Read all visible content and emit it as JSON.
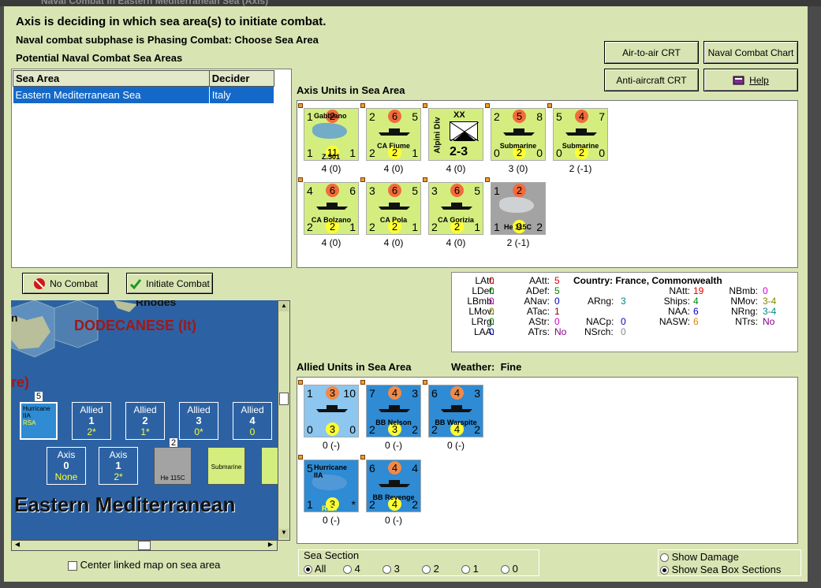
{
  "window_title": "Naval Combat in Eastern Mediterranean Sea (Axis)",
  "header": {
    "line1": "Axis is deciding in which sea area(s) to initiate combat.",
    "line2": "Naval combat subphase is Phasing Combat: Choose Sea Area",
    "line3": "Potential Naval Combat Sea Areas"
  },
  "toolbar": {
    "air_to_air": "Air-to-air CRT",
    "naval_chart": "Naval Combat Chart",
    "anti_aircraft": "Anti-aircraft CRT",
    "help": "Help"
  },
  "sea_table": {
    "col1": "Sea Area",
    "col2": "Decider",
    "rows": [
      {
        "sea": "Eastern Mediterranean Sea",
        "decider": "Italy"
      }
    ]
  },
  "actions": {
    "no_combat": "No Combat",
    "initiate": "Initiate Combat"
  },
  "axis_section": "Axis Units in Sea Area",
  "axis_units": [
    {
      "tl": "1",
      "tm": "2",
      "tr": "",
      "name": "Gabbiano",
      "sub": "Z.501",
      "bl": "1",
      "bm": "11",
      "br": "1",
      "cap": "4 (0)",
      "kind": "plane"
    },
    {
      "tl": "2",
      "tm": "6",
      "tr": "5",
      "name": "CA Fiume",
      "bl": "2",
      "bm": "2",
      "br": "1",
      "cap": "4 (0)",
      "kind": "ship"
    },
    {
      "tl": "",
      "tm": "XX",
      "tr": "",
      "name": "Alpini Div",
      "sub": "2-3",
      "bl": "",
      "bm": "",
      "br": "",
      "cap": "4 (0)",
      "kind": "army"
    },
    {
      "tl": "2",
      "tm": "5",
      "tr": "8",
      "name": "Submarine",
      "bl": "0",
      "bm": "2",
      "br": "0",
      "cap": "3 (0)",
      "kind": "sub"
    },
    {
      "tl": "5",
      "tm": "4",
      "tr": "7",
      "name": "Submarine",
      "bl": "0",
      "bm": "2",
      "br": "0",
      "cap": "2 (-1)",
      "kind": "sub"
    },
    {
      "tl": "4",
      "tm": "6",
      "tr": "6",
      "name": "CA Bolzano",
      "bl": "2",
      "bm": "2",
      "br": "1",
      "cap": "4 (0)",
      "kind": "ship"
    },
    {
      "tl": "3",
      "tm": "6",
      "tr": "5",
      "name": "CA Pola",
      "bl": "2",
      "bm": "2",
      "br": "1",
      "cap": "4 (0)",
      "kind": "ship"
    },
    {
      "tl": "3",
      "tm": "6",
      "tr": "5",
      "name": "CA Gorizia",
      "bl": "2",
      "bm": "2",
      "br": "1",
      "cap": "4 (0)",
      "kind": "ship"
    },
    {
      "tl": "1",
      "tm": "2",
      "tr": "",
      "name": "He 115C",
      "bl": "1",
      "bm": "9",
      "br": "2",
      "cap": "2 (-1)",
      "kind": "grey"
    }
  ],
  "stats": {
    "country_label": "Country:",
    "country": "France, Commonwealth",
    "c1": [
      [
        "LAtt:",
        "0"
      ],
      [
        "LDef:",
        "0"
      ],
      [
        "LBmb:",
        "0"
      ],
      [
        "LMov:",
        "0"
      ],
      [
        "LRrg:",
        "0"
      ],
      [
        "LAA:",
        "0"
      ]
    ],
    "c2": [
      [
        "AAtt:",
        "5"
      ],
      [
        "ADef:",
        "5"
      ],
      [
        "ANav:",
        "0"
      ],
      [
        "ATac:",
        "1"
      ],
      [
        "AStr:",
        "0"
      ],
      [
        "ATrs:",
        "No"
      ]
    ],
    "arng": [
      "ARng:",
      "3"
    ],
    "nacp": [
      "NACp:",
      "0"
    ],
    "nsrch": [
      "NSrch:",
      "0"
    ],
    "c4": [
      [
        "NAtt:",
        "19"
      ],
      [
        "Ships:",
        "4"
      ],
      [
        "NAA:",
        "6"
      ],
      [
        "NASW:",
        "6"
      ]
    ],
    "c5": [
      [
        "NBmb:",
        "0"
      ],
      [
        "NMov:",
        "3-4"
      ],
      [
        "NRng:",
        "3-4"
      ],
      [
        "NTrs:",
        "No"
      ]
    ]
  },
  "allied_section": "Allied Units in Sea Area",
  "weather_label": "Weather:",
  "weather": "Fine",
  "allied_units": [
    {
      "tl": "1",
      "tm": "3",
      "tr": "10",
      "name": "",
      "bl": "0",
      "bm": "3",
      "br": "0",
      "cap": "0 (-)",
      "kind": "lblue"
    },
    {
      "tl": "7",
      "tm": "4",
      "tr": "3",
      "name": "BB Nelson",
      "bl": "2",
      "bm": "3",
      "br": "2",
      "cap": "0 (-)",
      "kind": "blue"
    },
    {
      "tl": "6",
      "tm": "4",
      "tr": "3",
      "name": "BB Warspite",
      "bl": "2",
      "bm": "4",
      "br": "2",
      "cap": "0 (-)",
      "kind": "blue"
    },
    {
      "tl": "5",
      "tm": "",
      "tr": "",
      "name": "Hurricane IIA",
      "sub": "RSA",
      "bl": "1",
      "bm": "3",
      "br": "*",
      "cap": "0 (-)",
      "kind": "bplane"
    },
    {
      "tl": "6",
      "tm": "4",
      "tr": "4",
      "name": "BB Revenge",
      "bl": "2",
      "bm": "4",
      "br": "2",
      "cap": "0 (-)",
      "kind": "blue"
    }
  ],
  "map": {
    "rhodes": "Rhodes",
    "dodecanese": "DODECANESE (It)",
    "left_letter": "n",
    "re": "re)",
    "sea_name": "Eastern Mediterranean",
    "allied_boxes": [
      {
        "t": "Allied",
        "n": "1",
        "v": "2*"
      },
      {
        "t": "Allied",
        "n": "2",
        "v": "1*"
      },
      {
        "t": "Allied",
        "n": "3",
        "v": "0*"
      },
      {
        "t": "Allied",
        "n": "4",
        "v": "0"
      }
    ],
    "axis_boxes": [
      {
        "t": "Axis",
        "n": "0",
        "v": "None"
      },
      {
        "t": "Axis",
        "n": "1",
        "v": "2*"
      }
    ],
    "stack5": "5",
    "stack2": "2",
    "hurr": "Hurricane IIA",
    "he": "He 115C",
    "sub": "Submarine",
    "rsa": "RSA"
  },
  "center_map": "Center linked map on sea area",
  "sea_section": {
    "label": "Sea Section",
    "options": [
      "All",
      "4",
      "3",
      "2",
      "1",
      "0"
    ]
  },
  "show_damage": "Show Damage",
  "show_sea_box": "Show Sea Box Sections"
}
